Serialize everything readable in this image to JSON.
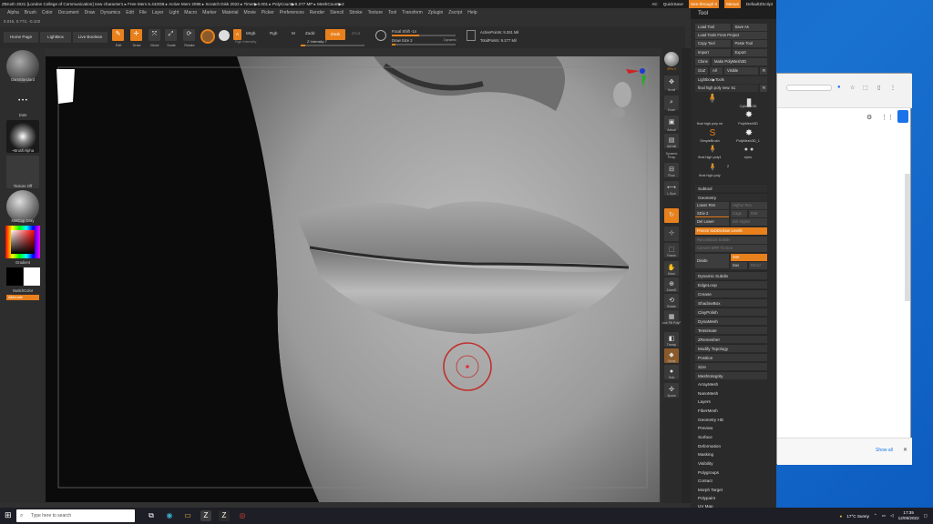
{
  "titlebar": {
    "text": "ZBrush 2021 [London College of Communication]  new character1  ▸ Free Mem 5.443GB ▸ Active Mem 2096 ▸ Scratch Disk 2022 ▸ Timer▶0.001 ▸ PolyCount▶9.277 MP ▸ MeshCount▶2",
    "ac": "AC",
    "quicksave": "QuickSave",
    "seethrough": "See-through  0",
    "menus": "Menus",
    "script": "DefaultZScript"
  },
  "menubar": [
    "Alpha",
    "Brush",
    "Color",
    "Document",
    "Draw",
    "Dynamics",
    "Edit",
    "File",
    "Layer",
    "Light",
    "Macro",
    "Marker",
    "Material",
    "Movie",
    "Picker",
    "Preferences",
    "Render",
    "Stencil",
    "Stroke",
    "Texture",
    "Tool",
    "Transform",
    "Zplugin",
    "Zscript",
    "Help"
  ],
  "info": "0.015, 0.772, -0.102",
  "toolbar": {
    "home": "Home Page",
    "lightbox": "LightBox",
    "live_boolean": "Live Boolean",
    "edit": "Edit",
    "draw": "Draw",
    "move": "Move",
    "scale": "Scale",
    "rotate": "Rotate",
    "a_btn": "A",
    "mrgb": "Mrgb",
    "rgb": "Rgb",
    "m": "M",
    "zadd": "Zadd",
    "zsub": "Zsub",
    "zcut": "Zcut",
    "rgb_intensity": "Rgb Intensity",
    "z_intensity": "Z Intensity 7",
    "focal_shift": "Focal Shift -14",
    "draw_size": "Draw Size 2",
    "dynamic": "Dynamic",
    "active_points": "ActivePoints: 9.261 Mil",
    "total_points": "TotalPoints: 9.277 Mil",
    "z_intensity_level": 0.07,
    "focal_shift_level": 0.43,
    "draw_size_level": 0.05
  },
  "leftshelf": {
    "brush": "DamStandard",
    "stroke": "Dots",
    "alpha": "~BrushAlpha",
    "texture": "Texture Off",
    "material": "MatCap Gray",
    "gradient": "Gradient",
    "switch": "SwitchColor",
    "alternate": "Alternate"
  },
  "rightshelf": [
    "BPR",
    "SPix 3",
    "Scroll",
    "Zoom",
    "Actual",
    "AAHalf",
    "Dynamic Persp",
    "Floor",
    "L.Sym",
    "Frame",
    "Move",
    "ZoomD",
    "Rotate",
    "Line Fill PolyF",
    "Transp",
    "Ghost",
    "Solo",
    "Xpose"
  ],
  "toolpanel": {
    "title": "Tool",
    "load_tool": "Load Tool",
    "save_as": "Save As",
    "load_from_project": "Load Tools From Project",
    "copy_tool": "Copy Tool",
    "paste_tool": "Paste Tool",
    "import": "Import",
    "export": "Export",
    "clone": "Clone",
    "make_polymesh": "Make PolyMesh3D",
    "goz": "GoZ",
    "all": "All",
    "visible": "Visible",
    "r": "R",
    "lightbox_tools": "Lightbox▶Tools",
    "current_tool": "final high poly new. 51",
    "current_count": "R",
    "thumbs": [
      "final high poly ne",
      "Cylinder3D",
      "PolyMesh3D",
      "SimpleBrush",
      "PolyMesh3D_1",
      "final high poly1",
      "eyes",
      "final high poly"
    ],
    "thumb_count": "2",
    "subtool": "Subtool",
    "geometry": "Geometry",
    "lower_res": "Lower Res",
    "higher_res": "Higher Res",
    "sdiv": "SDiv 2",
    "cage": "Cage",
    "rstr": "Rstr",
    "del_lower": "Del Lower",
    "del_higher": "Del Higher",
    "freeze_subdiv": "Freeze SubDivision Levels",
    "reconstruct": "Reconstruct Subdiv",
    "convert_bpr": "Convert BPR To Geo",
    "divide": "Divide",
    "smt": "Smt",
    "suv": "Suv",
    "reuv": "ReUV",
    "geometry_items": [
      "Dynamic Subdiv",
      "EdgeLoop",
      "Crease",
      "ShadowBox",
      "ClayPolish",
      "DynaMesh",
      "Tessimate",
      "ZRemesher",
      "Modify Topology",
      "Position",
      "Size",
      "MeshIntegrity"
    ],
    "sections": [
      "ArrayMesh",
      "NanoMesh",
      "Layers",
      "FiberMesh",
      "Geometry HD",
      "Preview",
      "Surface",
      "Deformation",
      "Masking",
      "Visibility",
      "Polygroups",
      "Contact",
      "Morph Target",
      "Polypaint",
      "UV Map"
    ]
  },
  "browser": {
    "show_all": "Show all"
  },
  "taskbar": {
    "search_placeholder": "Type here to search",
    "weather": "17°C  Sunny",
    "time": "17:35",
    "date": "12/05/2022"
  },
  "colors": {
    "accent": "#e8801c",
    "desktop": "#1560b8"
  }
}
